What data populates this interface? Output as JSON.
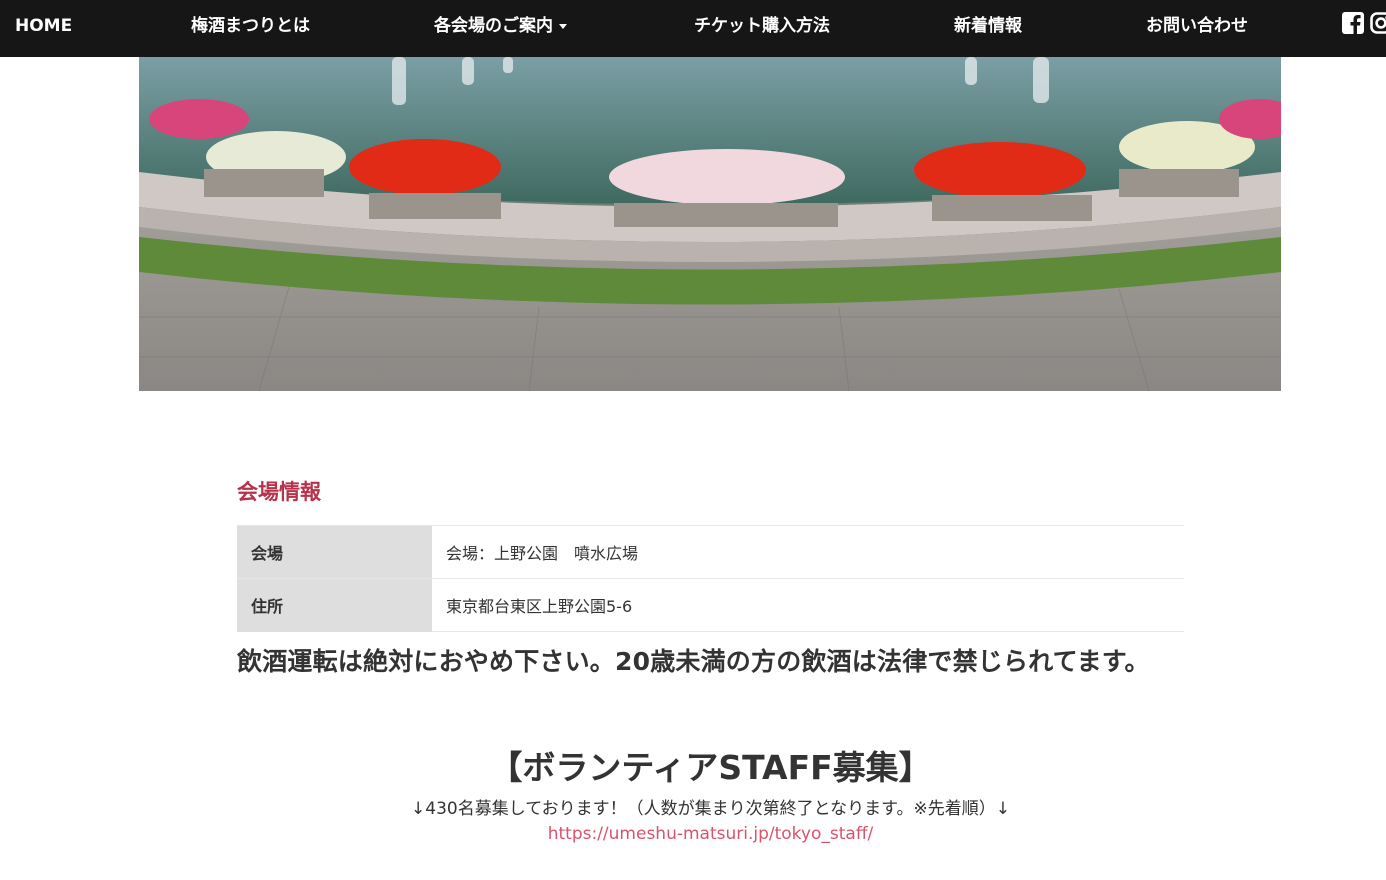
{
  "nav": {
    "home": "HOME",
    "about": "梅酒まつりとは",
    "venues": "各会場のご案内",
    "tickets": "チケット購入方法",
    "news": "新着情報",
    "contact": "お問い合わせ",
    "social": [
      "facebook-icon",
      "instagram-icon"
    ]
  },
  "hero": {
    "description_icon": "fountain-photo"
  },
  "venue_info": {
    "title": "会場情報",
    "rows": [
      {
        "label": "会場",
        "value": "会場：上野公園　噴水広場"
      },
      {
        "label": "住所",
        "value": "東京都台東区上野公園5-6"
      }
    ]
  },
  "notice": "飲酒運転は絶対におやめ下さい。20歳未満の方の飲酒は法律で禁じられてます。",
  "recruit": {
    "title": "【ボランティアSTAFF募集】",
    "subtitle": "↓430名募集しております！（人数が集まり次第終了となります。※先着順）↓",
    "link": "https://umeshu-matsuri.jp/tokyo_staff/"
  },
  "colors": {
    "nav_bg": "#161616",
    "accent": "#b7334c",
    "link": "#d9536d",
    "table_head": "#dedede"
  }
}
